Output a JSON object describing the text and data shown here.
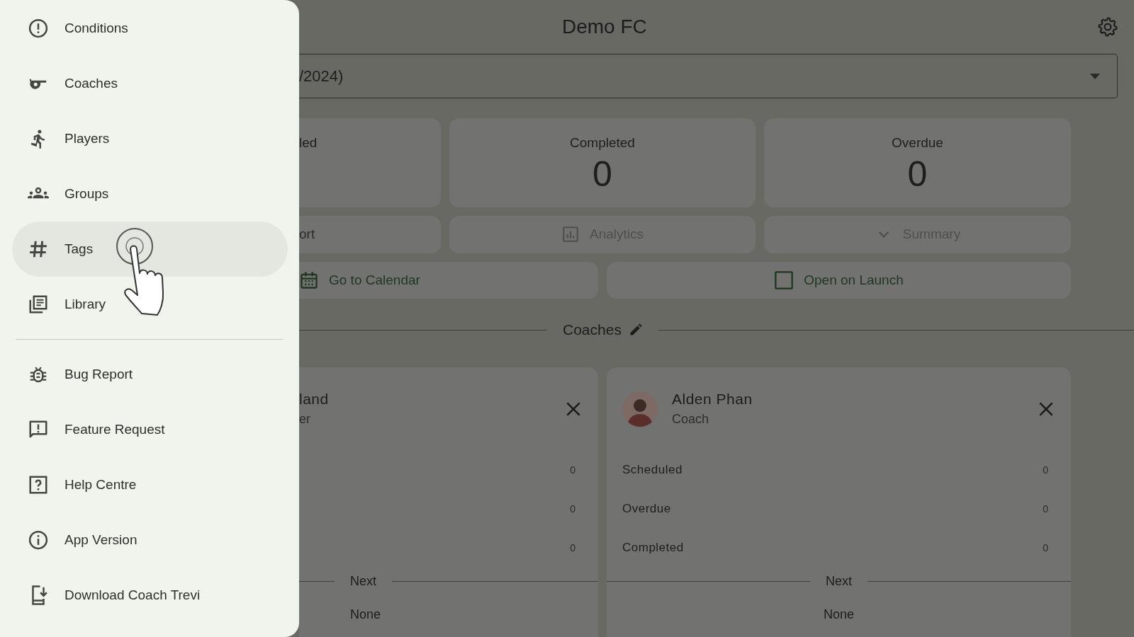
{
  "drawer": {
    "sections": [
      {
        "items": [
          {
            "label": "Conditions",
            "selected": false
          },
          {
            "label": "Coaches",
            "selected": false
          },
          {
            "label": "Players",
            "selected": false
          },
          {
            "label": "Groups",
            "selected": false
          },
          {
            "label": "Tags",
            "selected": true
          },
          {
            "label": "Library",
            "selected": false
          }
        ]
      },
      {
        "items": [
          {
            "label": "Bug Report",
            "selected": false
          },
          {
            "label": "Feature Request",
            "selected": false
          },
          {
            "label": "Help Centre",
            "selected": false
          },
          {
            "label": "App Version",
            "selected": false
          },
          {
            "label": "Download Coach Trevi",
            "selected": false
          }
        ]
      }
    ]
  },
  "main": {
    "title": "Demo FC",
    "season_select": {
      "value": "/2024)"
    },
    "stats": [
      {
        "label": "led"
      },
      {
        "label": "Completed",
        "value": "0"
      },
      {
        "label": "Overdue",
        "value": "0"
      }
    ],
    "actions": [
      {
        "label": "ort",
        "disabled": false
      },
      {
        "label": "Analytics",
        "disabled": true
      },
      {
        "label": "Summary",
        "disabled": true
      }
    ],
    "links": [
      {
        "kind": "calendar",
        "label": "Go to Calendar"
      },
      {
        "kind": "checkbox",
        "label": "Open on Launch",
        "checked": false
      }
    ],
    "coaches_heading": "Coaches",
    "coach_cards": [
      {
        "name": "land",
        "role": "er",
        "avatar": false,
        "stats": [
          {
            "value": "0"
          },
          {
            "value": "0"
          },
          {
            "value": "0"
          }
        ],
        "next_heading": "Next",
        "next_value": "None"
      },
      {
        "name": "Alden Phan",
        "role": "Coach",
        "avatar": true,
        "stats": [
          {
            "label": "Scheduled",
            "value": "0"
          },
          {
            "label": "Overdue",
            "value": "0"
          },
          {
            "label": "Completed",
            "value": "0"
          }
        ],
        "next_heading": "Next",
        "next_value": "None"
      }
    ]
  }
}
